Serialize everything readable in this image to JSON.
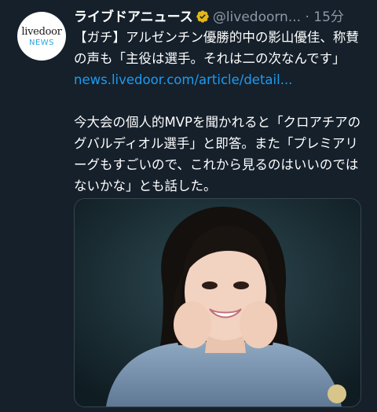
{
  "tweet": {
    "avatar": {
      "logo_top": "livedoor",
      "logo_bottom": "NEWS"
    },
    "display_name": "ライブドアニュース",
    "handle": "@livedoorn...",
    "separator": "·",
    "time": "15分",
    "paragraph1": "【ガチ】アルゼンチン優勝的中の影山優佳、称賛の声も「主役は選手。それは二の次なんです」",
    "link_text": "news.livedoor.com/article/detail...",
    "paragraph2": "今大会の個人的MVPを聞かれると「クロアチアのグバルディオル選手」と即答。また「プレミアリーグもすごいので、これから見るのはいいのではないかな」とも話した。"
  },
  "colors": {
    "background": "#15202b",
    "link": "#1d9bf0",
    "secondary_text": "#8b98a5",
    "verified_badge": "#e2b719"
  },
  "icons": {
    "verified": "verified-badge-icon"
  }
}
